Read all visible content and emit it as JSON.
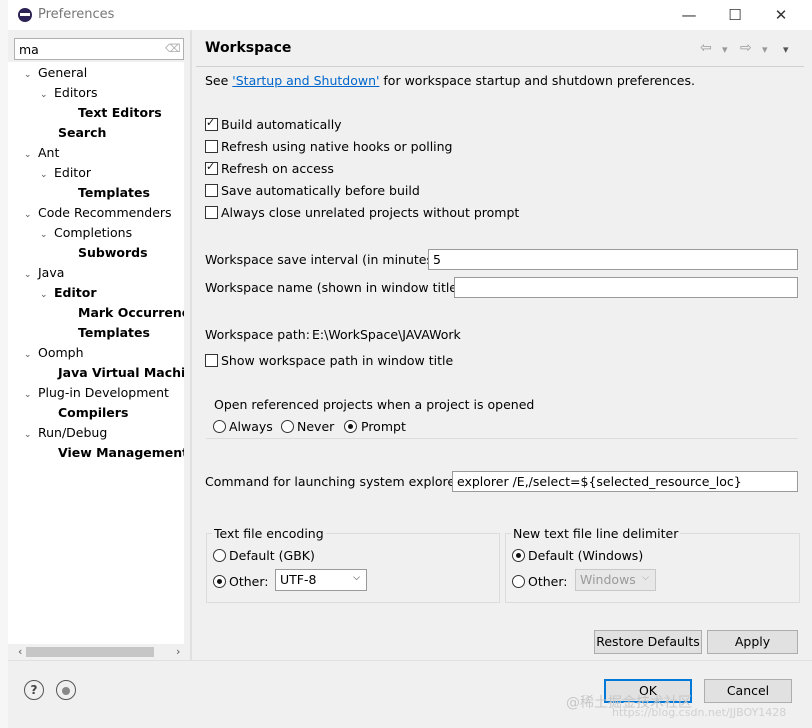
{
  "window": {
    "title": "Preferences",
    "minimize": "—",
    "maximize": "☐",
    "close": "✕"
  },
  "filter": {
    "value": "ma"
  },
  "tree": [
    {
      "label": "General",
      "toggle": "⌄",
      "bold": false
    },
    {
      "label": "Editors",
      "toggle": "⌄",
      "bold": false
    },
    {
      "label": "Text Editors",
      "toggle": "",
      "bold": true
    },
    {
      "label": "Search",
      "toggle": "",
      "bold": true
    },
    {
      "label": "Ant",
      "toggle": "⌄",
      "bold": false
    },
    {
      "label": "Editor",
      "toggle": "⌄",
      "bold": false
    },
    {
      "label": "Templates",
      "toggle": "",
      "bold": true
    },
    {
      "label": "Code Recommenders",
      "toggle": "⌄",
      "bold": false
    },
    {
      "label": "Completions",
      "toggle": "⌄",
      "bold": false
    },
    {
      "label": "Subwords",
      "toggle": "",
      "bold": true
    },
    {
      "label": "Java",
      "toggle": "⌄",
      "bold": false
    },
    {
      "label": "Editor",
      "toggle": "⌄",
      "bold": true
    },
    {
      "label": "Mark Occurrences",
      "toggle": "",
      "bold": true
    },
    {
      "label": "Templates",
      "toggle": "",
      "bold": true
    },
    {
      "label": "Oomph",
      "toggle": "⌄",
      "bold": false
    },
    {
      "label": "Java Virtual Machines",
      "toggle": "",
      "bold": true
    },
    {
      "label": "Plug-in Development",
      "toggle": "⌄",
      "bold": false
    },
    {
      "label": "Compilers",
      "toggle": "",
      "bold": true
    },
    {
      "label": "Run/Debug",
      "toggle": "⌄",
      "bold": false
    },
    {
      "label": "View Management",
      "toggle": "",
      "bold": true
    }
  ],
  "page": {
    "title": "Workspace",
    "nav": {
      "back": "⇦",
      "back_menu": "▾",
      "forward": "⇨",
      "forward_menu": "▾",
      "view_menu": "▾"
    },
    "intro_prefix": "See ",
    "intro_link": "'Startup and Shutdown'",
    "intro_suffix": " for workspace startup and shutdown preferences.",
    "checkboxes": [
      {
        "label": "Build automatically",
        "checked": true
      },
      {
        "label": "Refresh using native hooks or polling",
        "checked": false
      },
      {
        "label": "Refresh on access",
        "checked": true
      },
      {
        "label": "Save automatically before build",
        "checked": false
      },
      {
        "label": "Always close unrelated projects without prompt",
        "checked": false
      }
    ],
    "save_interval_label": "Workspace save interval (in minutes):",
    "save_interval_value": "5",
    "name_label": "Workspace name (shown in window title):",
    "name_value": "",
    "path_label": "Workspace path:",
    "path_value": "E:\\WorkSpace\\JAVAWork",
    "show_path_label": "Show workspace path in window title",
    "show_path_checked": false,
    "open_ref_title": "Open referenced projects when a project is opened",
    "open_ref_options": [
      {
        "label": "Always",
        "checked": false
      },
      {
        "label": "Never",
        "checked": false
      },
      {
        "label": "Prompt",
        "checked": true
      }
    ],
    "explorer_label": "Command for launching system explorer:",
    "explorer_value": "explorer /E,/select=${selected_resource_loc}",
    "encoding": {
      "title": "Text file encoding",
      "default_label": "Default (GBK)",
      "default_checked": false,
      "other_label": "Other:",
      "other_checked": true,
      "other_value": "UTF-8"
    },
    "delimiter": {
      "title": "New text file line delimiter",
      "default_label": "Default (Windows)",
      "default_checked": true,
      "other_label": "Other:",
      "other_checked": false,
      "other_value": "Windows"
    },
    "restore_label": "Restore Defaults",
    "apply_label": "Apply"
  },
  "footer": {
    "help_icon": "?",
    "ok_label": "OK",
    "cancel_label": "Cancel",
    "watermark": "@稀土掘金技术社区",
    "watermark_url": "https://blog.csdn.net/JJBOY1428"
  },
  "colors": {
    "accent": "#0078d7",
    "link": "#0066cc"
  }
}
